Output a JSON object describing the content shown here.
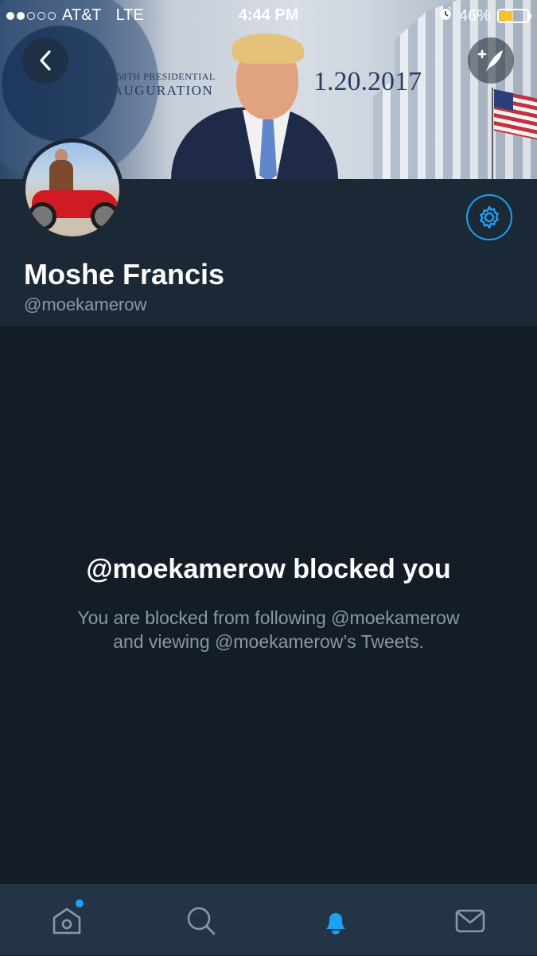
{
  "status_bar": {
    "carrier": "AT&T",
    "network": "LTE",
    "time": "4:44 PM",
    "battery_percent": "46%",
    "battery_level": 0.46,
    "signal_bars": 2,
    "signal_total": 5
  },
  "banner": {
    "inauguration_line1": "THE 58TH PRESIDENTIAL",
    "inauguration_line2": "INAUGURATION",
    "date": "1.20.2017"
  },
  "profile": {
    "display_name": "Moshe Francis",
    "handle": "@moekamerow"
  },
  "blocked": {
    "title": "@moekamerow blocked you",
    "line1": "You are blocked from following @moekamerow",
    "line2": "and viewing @moekamerow’s Tweets."
  },
  "tab_bar": {
    "items": [
      {
        "icon": "home-icon",
        "active": false,
        "has_notification_dot": true
      },
      {
        "icon": "search-icon",
        "active": false
      },
      {
        "icon": "bell-icon",
        "active": true
      },
      {
        "icon": "mail-icon",
        "active": false
      }
    ]
  },
  "colors": {
    "accent": "#1da1f2",
    "background": "#141d26",
    "profile_background": "#1b2836",
    "tab_bar_background": "#243447",
    "muted_text": "#8899a6",
    "battery_fill": "#f7c51e"
  }
}
